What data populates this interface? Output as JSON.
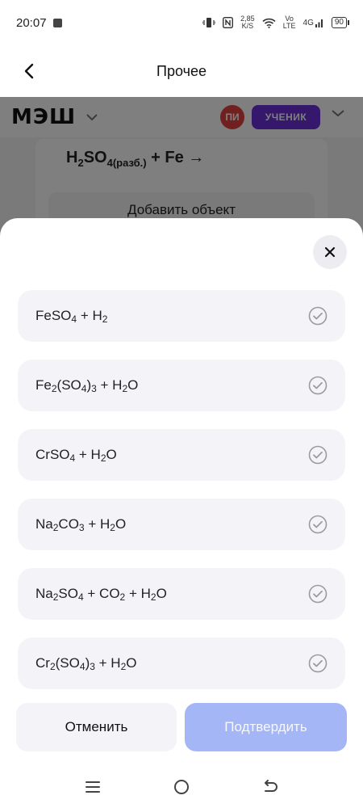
{
  "status_bar": {
    "time": "20:07",
    "speed_value": "2,85",
    "speed_unit": "K/S",
    "volte_top": "Vo",
    "volte_bottom": "LTE",
    "network": "4G",
    "battery": "90"
  },
  "header": {
    "title": "Прочее"
  },
  "background": {
    "logo": "МЭШ",
    "avatar_initials": "ПИ",
    "role_badge": "УЧЕНИК",
    "equation": {
      "p1": "H",
      "s1": "2",
      "p2": "SO",
      "s2": "4(разб.)",
      "p3": " + Fe →"
    },
    "add_object": "Добавить объект"
  },
  "options": [
    {
      "parts": [
        {
          "t": "FeSO"
        },
        {
          "s": "4"
        },
        {
          "t": " + H"
        },
        {
          "s": "2"
        }
      ]
    },
    {
      "parts": [
        {
          "t": "Fe"
        },
        {
          "s": "2"
        },
        {
          "t": "(SO"
        },
        {
          "s": "4"
        },
        {
          "t": ")"
        },
        {
          "s": "3"
        },
        {
          "t": " + H"
        },
        {
          "s": "2"
        },
        {
          "t": "O"
        }
      ]
    },
    {
      "parts": [
        {
          "t": "CrSO"
        },
        {
          "s": "4"
        },
        {
          "t": " + H"
        },
        {
          "s": "2"
        },
        {
          "t": "O"
        }
      ]
    },
    {
      "parts": [
        {
          "t": "Na"
        },
        {
          "s": "2"
        },
        {
          "t": "CO"
        },
        {
          "s": "3"
        },
        {
          "t": " + H"
        },
        {
          "s": "2"
        },
        {
          "t": "O"
        }
      ]
    },
    {
      "parts": [
        {
          "t": "Na"
        },
        {
          "s": "2"
        },
        {
          "t": "SO"
        },
        {
          "s": "4"
        },
        {
          "t": " + CO"
        },
        {
          "s": "2"
        },
        {
          "t": " + H"
        },
        {
          "s": "2"
        },
        {
          "t": "O"
        }
      ]
    },
    {
      "parts": [
        {
          "t": "Cr"
        },
        {
          "s": "2"
        },
        {
          "t": "(SO"
        },
        {
          "s": "4"
        },
        {
          "t": ")"
        },
        {
          "s": "3"
        },
        {
          "t": " + H"
        },
        {
          "s": "2"
        },
        {
          "t": "O"
        }
      ]
    }
  ],
  "actions": {
    "cancel": "Отменить",
    "confirm": "Подтвердить"
  },
  "colors": {
    "accent_confirm_disabled": "#a4b6f5",
    "role_badge": "#6b2fd9",
    "avatar": "#e0403c",
    "option_bg": "#f4f4f8"
  },
  "icons": {
    "back": "chevron-left-icon",
    "close": "close-icon",
    "check": "check-circle-icon",
    "nav_menu": "menu-icon",
    "nav_home": "home-circle-icon",
    "nav_back": "back-arrow-icon"
  }
}
